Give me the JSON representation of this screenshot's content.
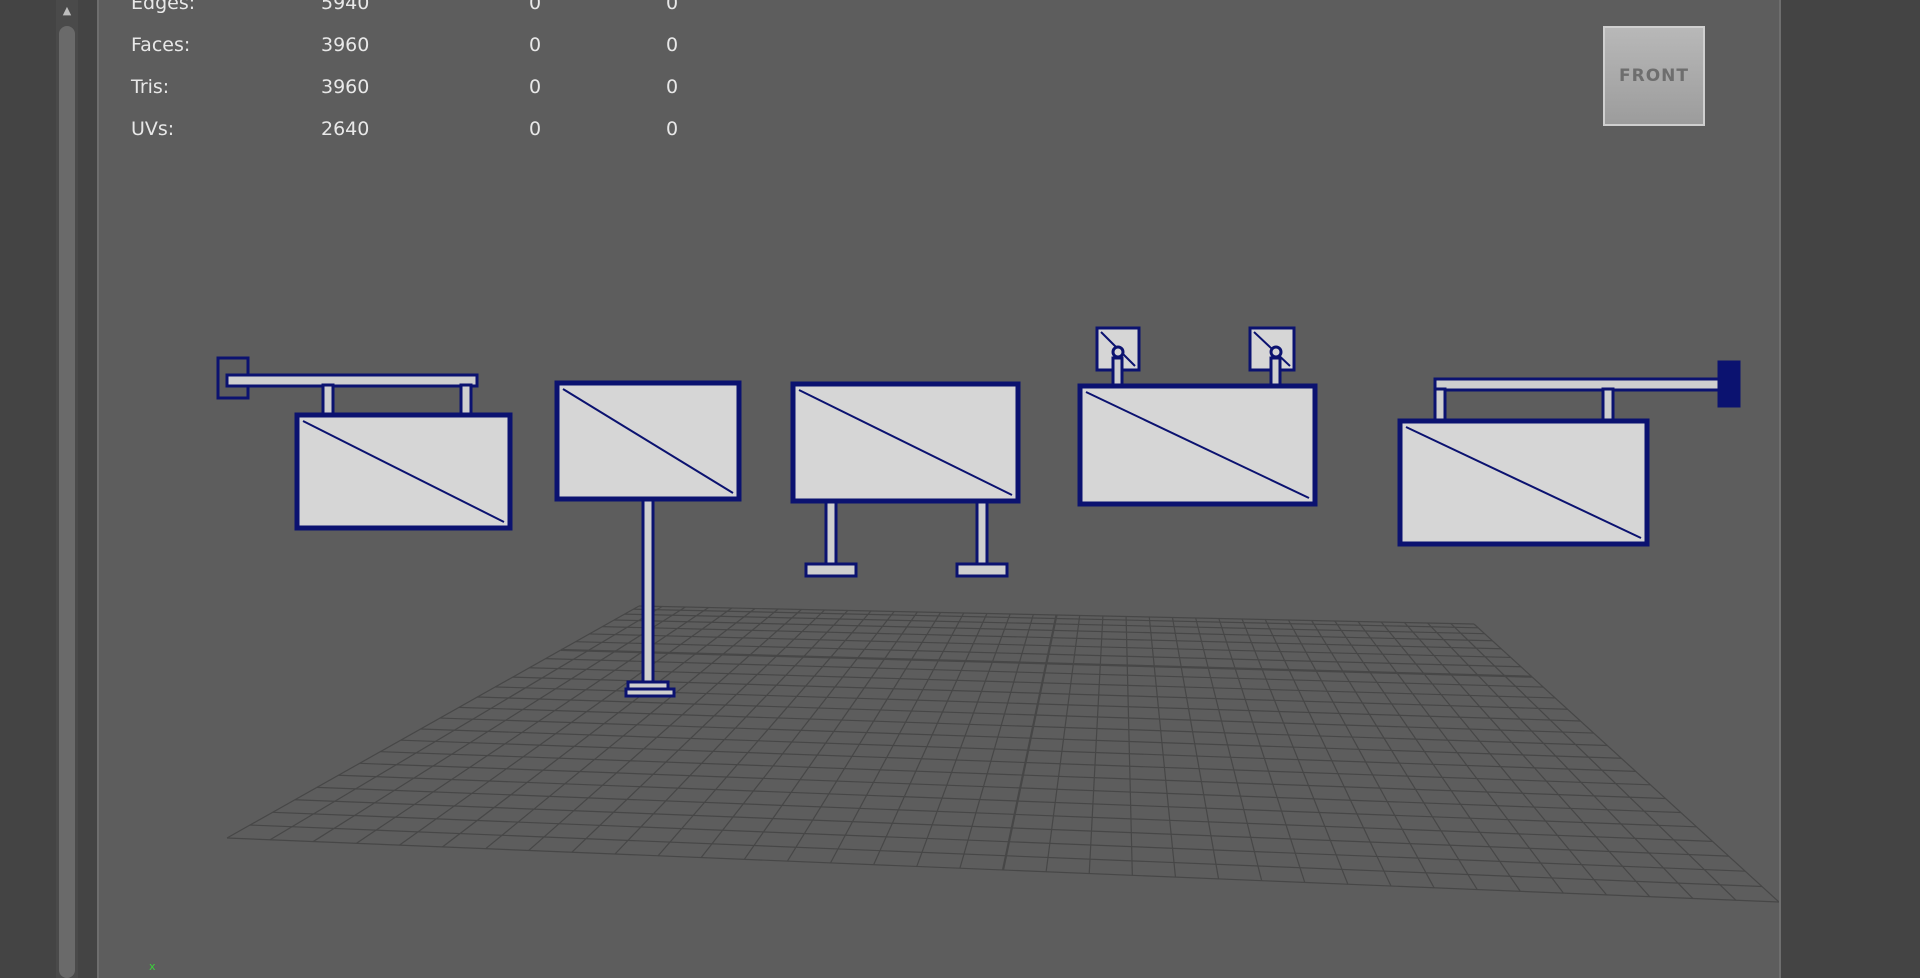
{
  "hud": {
    "rows": [
      {
        "label": "Edges:",
        "v1": "5940",
        "v2": "0",
        "v3": "0"
      },
      {
        "label": "Faces:",
        "v1": "3960",
        "v2": "0",
        "v3": "0"
      },
      {
        "label": "Tris:",
        "v1": "3960",
        "v2": "0",
        "v3": "0"
      },
      {
        "label": "UVs:",
        "v1": "2640",
        "v2": "0",
        "v3": "0"
      }
    ]
  },
  "viewcube": {
    "label": "FRONT"
  },
  "scrollbar": {
    "up_arrow_icon": "up-arrow-icon"
  },
  "colors": {
    "viewport_bg": "#5d5d5d",
    "wireframe": "#0b1270",
    "screen_fill": "#d6d6d6",
    "grid": "#464646"
  }
}
